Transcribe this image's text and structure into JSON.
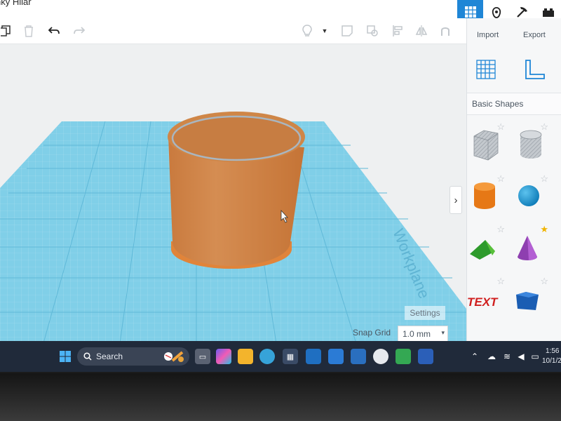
{
  "app": {
    "title": "nky Hilar"
  },
  "toolbar": {
    "import_label": "Import",
    "export_label": "Export"
  },
  "shapes_panel": {
    "title": "Basic Shapes",
    "shapes": [
      {
        "name": "box-striped",
        "favorited": false
      },
      {
        "name": "cylinder-striped",
        "favorited": false
      },
      {
        "name": "cylinder",
        "favorited": false
      },
      {
        "name": "sphere",
        "favorited": false
      },
      {
        "name": "roof",
        "favorited": false
      },
      {
        "name": "cone",
        "favorited": true
      },
      {
        "name": "text",
        "label": "TEXT",
        "favorited": false
      },
      {
        "name": "box",
        "favorited": false
      }
    ]
  },
  "workplane": {
    "label": "Workplane",
    "settings_label": "Settings",
    "snap_grid_label": "Snap Grid",
    "snap_grid_value": "1.0 mm"
  },
  "taskbar": {
    "search_placeholder": "Search",
    "time": "1:56",
    "date": "10/1/2"
  },
  "colors": {
    "accent": "#1f86d6",
    "workplane": "#7fd0ea",
    "object": "#d2874a",
    "taskbar": "#202a3a"
  }
}
